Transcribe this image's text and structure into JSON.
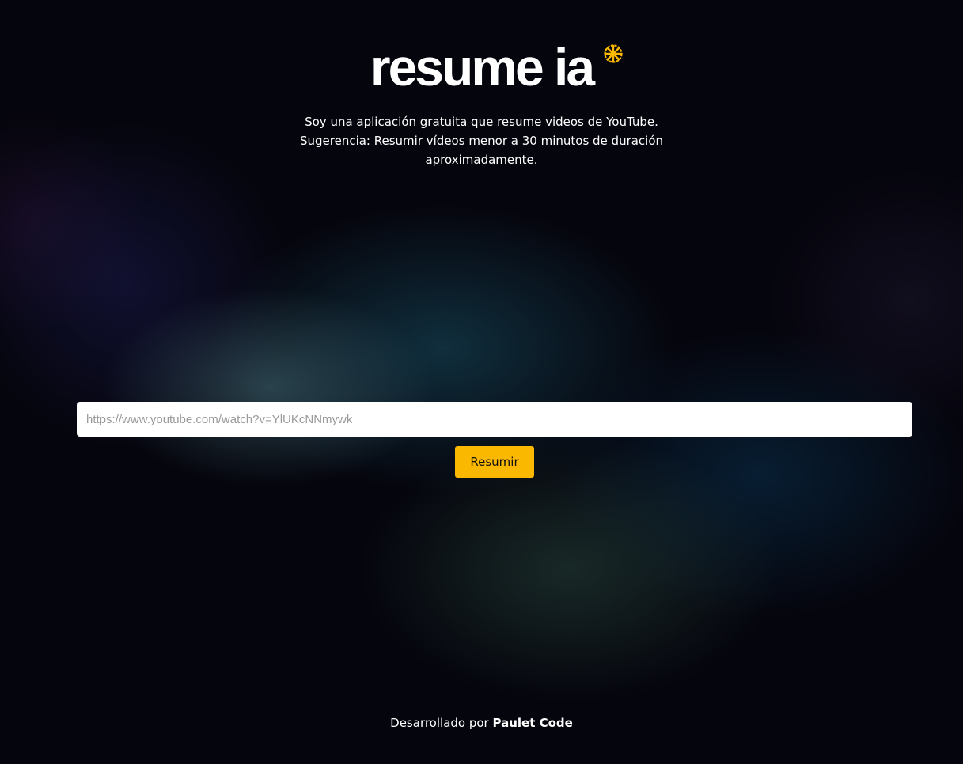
{
  "app": {
    "logo_text": "resume ia",
    "logo_mark_icon": "sunburst-icon",
    "accent_color": "#fbb800"
  },
  "intro": {
    "line1": "Soy una aplicación gratuita que resume videos de YouTube.",
    "line2": "Sugerencia: Resumir vídeos menor a 30 minutos de duración aproximadamente."
  },
  "form": {
    "url_placeholder": "https://www.youtube.com/watch?v=YlUKcNNmywk",
    "url_value": "",
    "submit_label": "Resumir"
  },
  "footer": {
    "prefix": "Desarrollado por",
    "author": "Paulet Code"
  }
}
